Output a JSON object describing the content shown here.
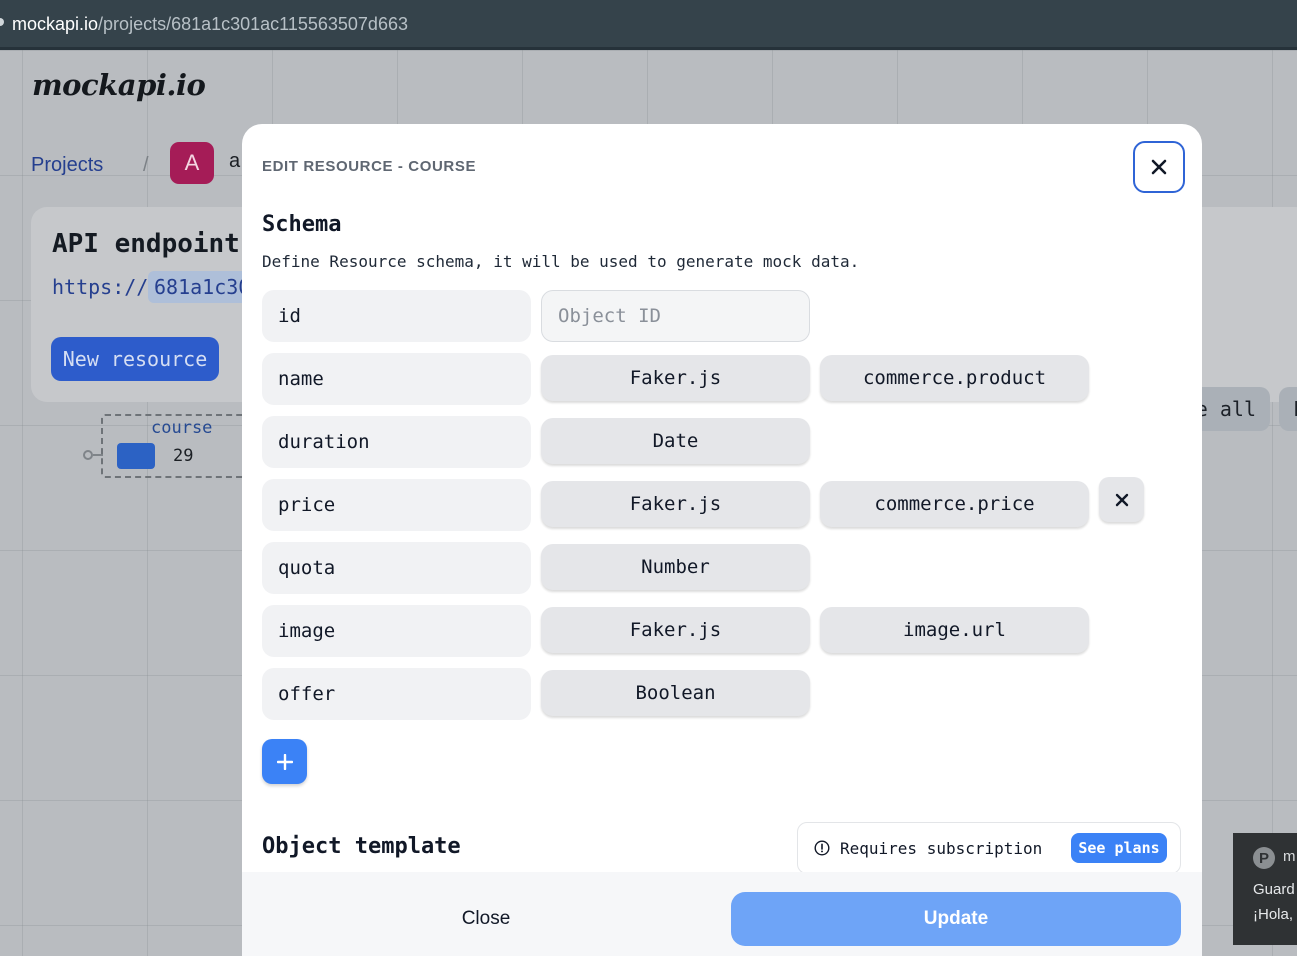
{
  "browser": {
    "url_host": "mockapi.io",
    "url_path": "/projects/681a1c301ac115563507d663"
  },
  "background": {
    "logo": "mockapi.io",
    "breadcrumb": {
      "projects": "Projects",
      "separator": "/",
      "avatar_letter": "A",
      "project_partial": "a"
    },
    "endpoint_card": {
      "title": "API endpoint",
      "protocol": "https://",
      "endpoint_partial": "681a1c30",
      "new_resource_label": "New resource",
      "right_pill_1": "e all",
      "right_pill_2": "F"
    },
    "resource_node": {
      "name": "course",
      "count": "29"
    }
  },
  "toast": {
    "app": "m",
    "line1": "Guard",
    "line2": "¡Hola,"
  },
  "modal": {
    "title": "EDIT RESOURCE - COURSE",
    "close_icon": "close-icon",
    "schema_heading": "Schema",
    "schema_description": "Define Resource schema, it will be used to generate mock data.",
    "fields": [
      {
        "name": "id",
        "placeholder": "Object ID"
      },
      {
        "name": "name",
        "type": "Faker.js",
        "method": "commerce.product"
      },
      {
        "name": "duration",
        "type": "Date"
      },
      {
        "name": "price",
        "type": "Faker.js",
        "method": "commerce.price"
      },
      {
        "name": "quota",
        "type": "Number"
      },
      {
        "name": "image",
        "type": "Faker.js",
        "method": "image.url"
      },
      {
        "name": "offer",
        "type": "Boolean"
      }
    ],
    "add_field_icon": "plus-icon",
    "template_heading": "Object template",
    "subscription": {
      "text": "Requires subscription",
      "link": "See plans"
    },
    "footer": {
      "close": "Close",
      "update": "Update"
    }
  },
  "colors": {
    "accent": "#3b82f6",
    "update_button": "#6ea4f7"
  }
}
